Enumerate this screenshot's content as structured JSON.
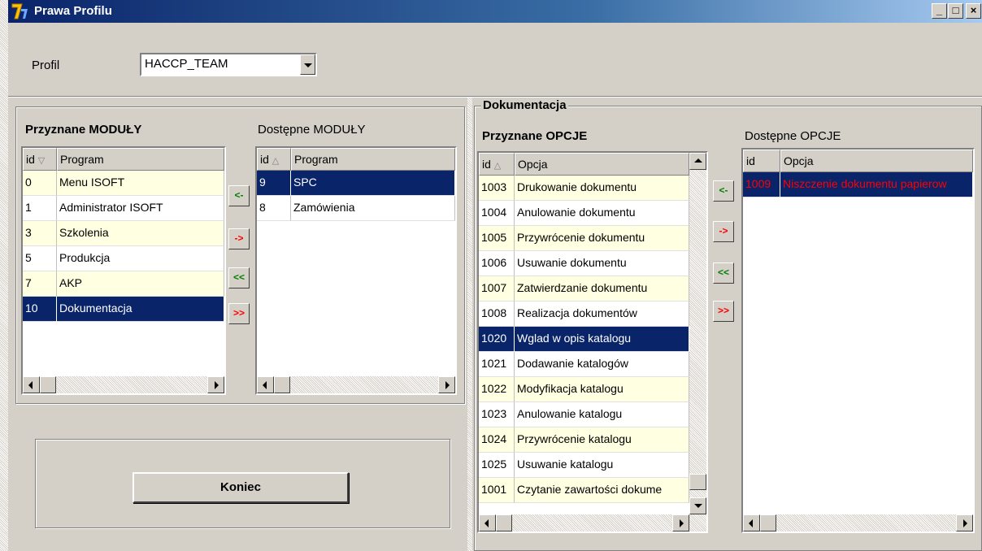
{
  "window": {
    "title": "Prawa Profilu",
    "minimize": "_",
    "maximize": "□",
    "close": "×"
  },
  "profile": {
    "label": "Profil",
    "value": "HACCP_TEAM"
  },
  "modules": {
    "assigned_title": "Przyznane MODUŁY",
    "available_title": "Dostępne MODUŁY",
    "assigned_headers": [
      "id",
      "Program"
    ],
    "available_headers": [
      "id",
      "Program"
    ],
    "assigned_rows": [
      {
        "id": "0",
        "name": "Menu ISOFT"
      },
      {
        "id": "1",
        "name": "Administrator ISOFT"
      },
      {
        "id": "3",
        "name": "Szkolenia"
      },
      {
        "id": "5",
        "name": "Produkcja"
      },
      {
        "id": "7",
        "name": "AKP"
      },
      {
        "id": "10",
        "name": "Dokumentacja"
      }
    ],
    "available_rows": [
      {
        "id": "9",
        "name": "SPC"
      },
      {
        "id": "8",
        "name": "Zamówienia"
      }
    ]
  },
  "transfer_buttons": {
    "add_one": "<-",
    "remove_one": "->",
    "add_all": "<<",
    "remove_all": ">>"
  },
  "options": {
    "group_title": "Dokumentacja",
    "assigned_title": "Przyznane OPCJE",
    "available_title": "Dostępne OPCJE",
    "assigned_headers": [
      "id",
      "Opcja"
    ],
    "available_headers": [
      "id",
      "Opcja"
    ],
    "assigned_rows": [
      {
        "id": "1003",
        "name": "Drukowanie dokumentu"
      },
      {
        "id": "1004",
        "name": "Anulowanie dokumentu"
      },
      {
        "id": "1005",
        "name": "Przywrócenie dokumentu"
      },
      {
        "id": "1006",
        "name": "Usuwanie dokumentu"
      },
      {
        "id": "1007",
        "name": "Zatwierdzanie dokumentu"
      },
      {
        "id": "1008",
        "name": "Realizacja dokumentów"
      },
      {
        "id": "1020",
        "name": "Wglad w opis katalogu"
      },
      {
        "id": "1021",
        "name": "Dodawanie katalogów"
      },
      {
        "id": "1022",
        "name": "Modyfikacja katalogu"
      },
      {
        "id": "1023",
        "name": "Anulowanie katalogu"
      },
      {
        "id": "1024",
        "name": "Przywrócenie katalogu"
      },
      {
        "id": "1025",
        "name": "Usuwanie katalogu"
      },
      {
        "id": "1001",
        "name": "Czytanie zawartości dokume"
      }
    ],
    "available_rows": [
      {
        "id": "1009",
        "name": "Niszczenie dokumentu papierow"
      }
    ]
  },
  "end_button": "Koniec"
}
